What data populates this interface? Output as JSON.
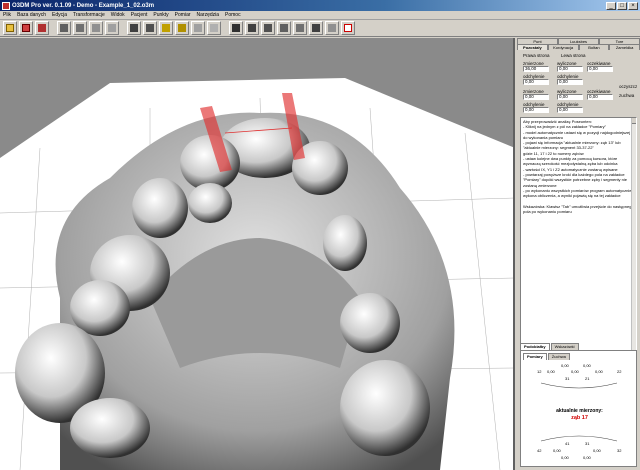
{
  "window": {
    "title": "O3DM Pro ver. 0.1.09 - Demo - Example_1_02.o3m"
  },
  "menu": [
    "Plik",
    "Baza danych",
    "Edycja",
    "Transformacje",
    "Widok",
    "Pacjent",
    "Punkty",
    "Pomiar",
    "Narzędzia",
    "Pomoc"
  ],
  "toolbar": {
    "buttons": [
      "open-icon",
      "save-icon",
      "print-icon",
      "mesh-icon",
      "tool-icon",
      "edit-icon",
      "measure-icon",
      "grid-icon",
      "model-icon",
      "model2-icon",
      "frame-icon",
      "frame2-icon",
      "undo-icon",
      "view-icon",
      "layout-icon",
      "transform-icon",
      "column-icon",
      "ruler-icon",
      "chart-icon",
      "list-icon",
      "dice-icon"
    ]
  },
  "panel": {
    "top_tabs": [
      "Punt",
      "Luuksbes",
      "Tore"
    ],
    "second_tabs": [
      "Pozostały",
      "Kordynacja",
      "Boltan",
      "Zameldka"
    ],
    "group_label": "Prawa strona",
    "group_label2": "Lewa strona",
    "col1_label": "zmierzone",
    "col2_label": "wyliczone",
    "col3_label": "oczekiwane",
    "row1": [
      "36,00",
      "0,00",
      "0,00"
    ],
    "diff_label": "odchylenie",
    "row2": [
      "0,00",
      "0,00"
    ],
    "side_label1": "oczyszcz",
    "side_label2": "zuchwa",
    "row3": [
      "0,00",
      "0,00",
      "0,00"
    ],
    "row4": [
      "0,00",
      "0,00"
    ],
    "memo": "Aby przeprowadzić analizę Poseunten:\n- Kliknij na jednym z pól na zakładce \"Pomiary\"\n- model automatycznie ustawi się w pozycji najdogodniejszej do wykonania pomiaru\n- pojawi się informacja \"aktualnie mierzony: ząb 13\" lub \"aktualnie mierzony: segment 33-37-22\"\ngdzie 11, 17 i 22 to numery zębów\n- ustaw kolejne dwa punkty za pomocą kursora, które wyznaczą szerokość mezjodystalną zęba lub odcinka\n- wartości IX, Y1 i Z2 automatycznie zostaną wpisane\n- powtarzaj powyższe kroki dla każdego pola na zakładce \"Pomiary\" dopóki wszystkie potrzebne zęby i segmenty nie zostaną zmierzone\n- po wykonaniu wszystkich pomiarów program automatycznie wykona obliczenia, a wyniki pojawią się na tej zakładce\n\nWskazówka: Klawisz \"Tab\" umożliwia przejście do następnego pola po wykonaniu pomiaru",
    "sub_tabs": [
      "Podobiałby",
      "Wskazówki"
    ],
    "inner_tabs": [
      "Pomiary",
      "Żuchwa"
    ],
    "upper_values": {
      "row_a": [
        "0,00",
        "0,00"
      ],
      "labels": [
        "12",
        "0,00",
        "0,00",
        "0,00",
        "22"
      ],
      "mid": [
        "31",
        "21"
      ]
    },
    "current_label": "aktualnie mierzony:",
    "current_value": "ząb 17",
    "lower_values": {
      "labels": [
        "42",
        "0,00",
        "0,00",
        "32"
      ],
      "mid": [
        "41",
        "31"
      ],
      "row_b": [
        "0,00",
        "0,00"
      ]
    }
  }
}
